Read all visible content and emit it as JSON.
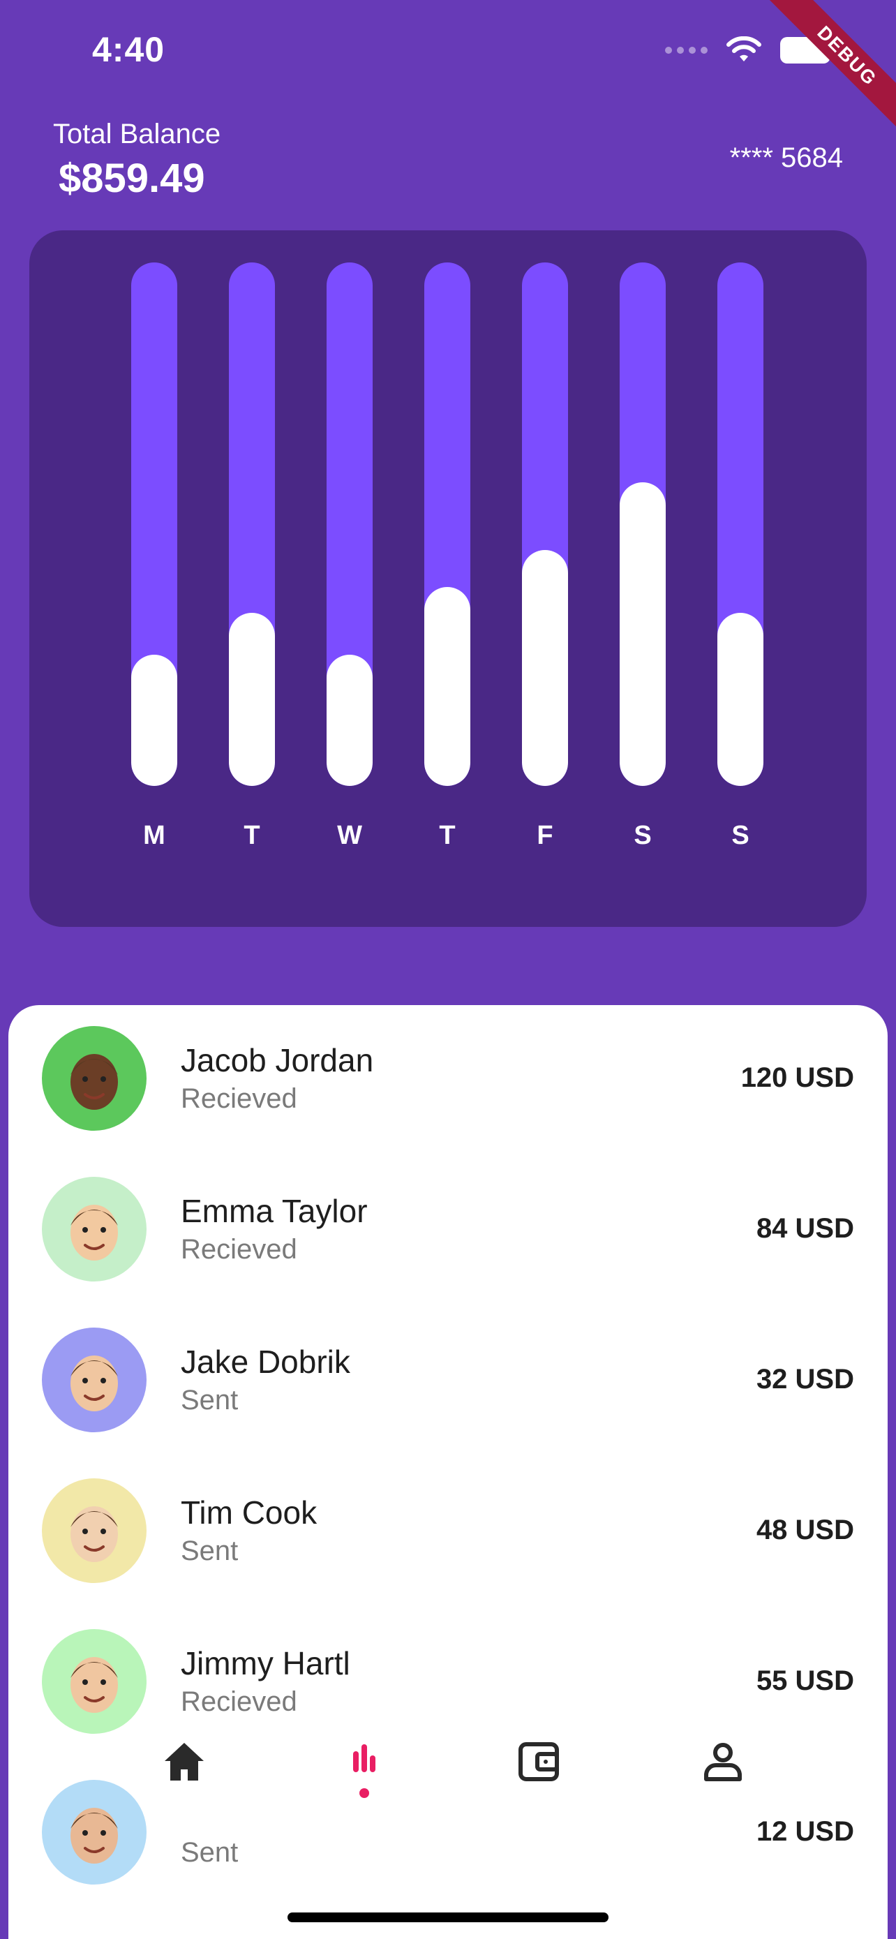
{
  "status_bar": {
    "time": "4:40"
  },
  "debug_banner": "DEBUG",
  "header": {
    "balance_label": "Total Balance",
    "balance_value": "$859.49",
    "card_number": "**** 5684"
  },
  "chart_data": {
    "type": "bar",
    "categories": [
      "M",
      "T",
      "W",
      "T",
      "F",
      "S",
      "S"
    ],
    "values": [
      0.25,
      0.33,
      0.25,
      0.38,
      0.45,
      0.58,
      0.33
    ],
    "ylim": [
      0,
      1
    ],
    "colors": {
      "track": "#7c4dff",
      "fill": "#ffffff",
      "card": "#4a2886"
    }
  },
  "transactions": [
    {
      "name": "Jacob Jordan",
      "status": "Recieved",
      "amount": "120 USD",
      "avatar_bg": "#5cc85c",
      "skin": "#6b3e26"
    },
    {
      "name": "Emma Taylor",
      "status": "Recieved",
      "amount": "84 USD",
      "avatar_bg": "#c5efc9",
      "skin": "#f2c9a0"
    },
    {
      "name": "Jake Dobrik",
      "status": "Sent",
      "amount": "32 USD",
      "avatar_bg": "#9b9bf3",
      "skin": "#f0c6a0"
    },
    {
      "name": "Tim Cook",
      "status": "Sent",
      "amount": "48 USD",
      "avatar_bg": "#f2e8a8",
      "skin": "#f1d0b0"
    },
    {
      "name": "Jimmy Hartl",
      "status": "Recieved",
      "amount": "55 USD",
      "avatar_bg": "#b9f5b9",
      "skin": "#f0c6a0"
    },
    {
      "name": "",
      "status": "Sent",
      "amount": "12 USD",
      "avatar_bg": "#b3dcf7",
      "skin": "#e8b894"
    }
  ],
  "nav": {
    "items": [
      "home-icon",
      "stats-icon",
      "wallet-icon",
      "profile-icon"
    ],
    "active_index": 1,
    "active_color": "#e91e63",
    "inactive_color": "#2a2a2a"
  }
}
